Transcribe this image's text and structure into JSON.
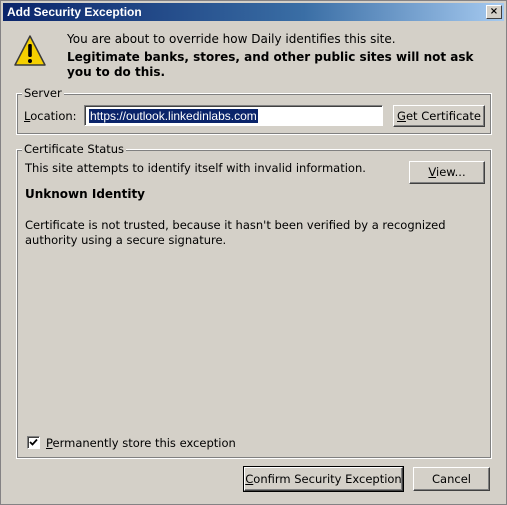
{
  "window": {
    "title": "Add Security Exception",
    "close_glyph": "×"
  },
  "intro": {
    "line": "You are about to override how Daily identifies this site.",
    "warning": "Legitimate banks, stores, and other public sites will not ask you to do this.",
    "icon": "warning-triangle-icon"
  },
  "server": {
    "legend": "Server",
    "location_label": "Location:",
    "location_value": "https://outlook.linkedinlabs.com",
    "get_certificate_label": "Get Certificate"
  },
  "certificate": {
    "legend": "Certificate Status",
    "description": "This site attempts to identify itself with invalid information.",
    "view_label": "View...",
    "identity_heading": "Unknown Identity",
    "trust_message": "Certificate is not trusted, because it hasn't been verified by a recognized authority using a secure signature."
  },
  "permanent_store": {
    "checked": true,
    "label": "Permanently store this exception"
  },
  "actions": {
    "confirm_label": "Confirm Security Exception",
    "cancel_label": "Cancel"
  },
  "colors": {
    "dialog_bg": "#d4d0c8",
    "titlebar_start": "#0a246a",
    "titlebar_end": "#a6caf0",
    "selection": "#0a246a",
    "warning_yellow": "#f5d000"
  }
}
